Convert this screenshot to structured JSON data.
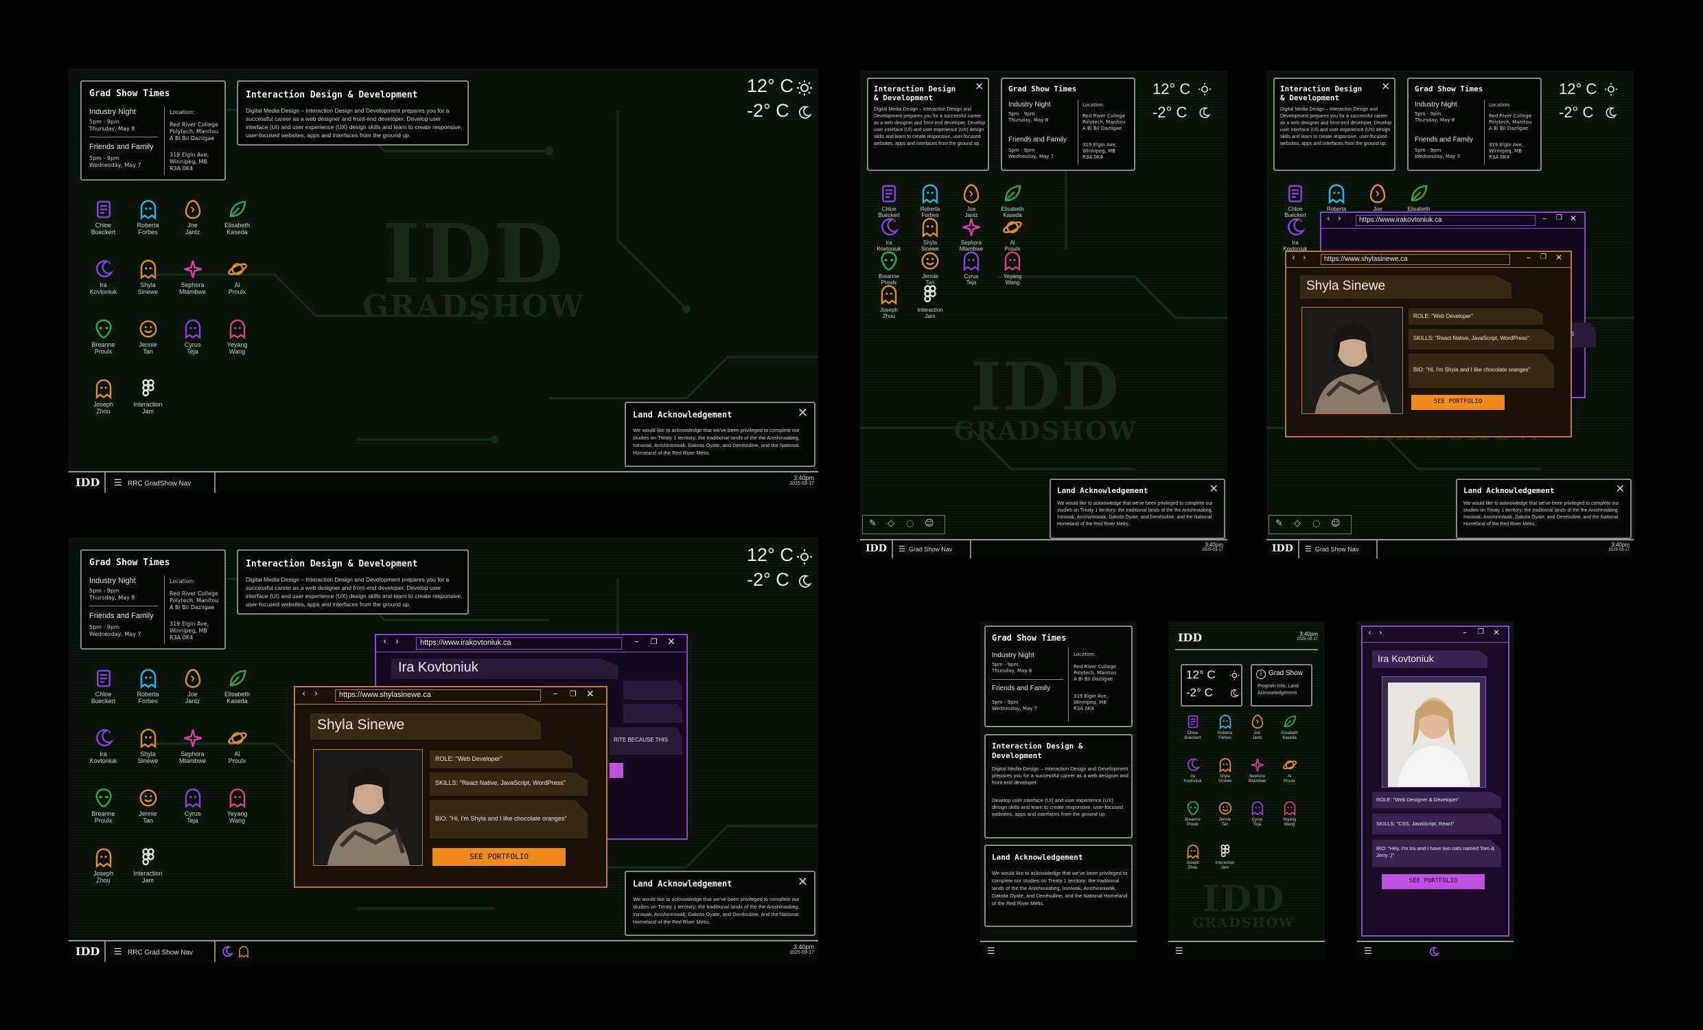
{
  "grad_show": {
    "title": "Grad Show Times",
    "industry_title": "Industry Night",
    "industry_time": "5pm - 9pm",
    "industry_date": "Thursday, May 8",
    "friends_title": "Friends and Family",
    "friends_time": "5pm - 9pm",
    "friends_date": "Wednesday, May 7",
    "location_label": "Location:",
    "location_1_l1": "Red River College",
    "location_1_l2": "Polytech, Manitou",
    "location_1_l3": "A Bi Bii Daziigae",
    "location_2_l1": "319 Elgin Ave,",
    "location_2_l2": "Winnipeg, MB",
    "location_2_l3": "R3A 0K4"
  },
  "idd": {
    "title": "Interaction Design & Development",
    "title_l1": "Interaction Design",
    "title_l2": "& Development",
    "body": "Digital Media Design – Interaction Design and Development prepares you for a successful career as a web designer and front-end developer. Develop user interface (UI) and user experience (UX) design skills and learn to create responsive, user-focused websites, apps and interfaces from the ground up.",
    "body_p1": "Digital Media Design – Interaction Design and Development prepares you for a successful career as a web designer and front-end developer.",
    "body_p2": "Develop user interface (UI) and user experience (UX) design skills and learn to create responsive, user-focused websites, apps and interfaces from the ground up."
  },
  "land": {
    "title": "Land Acknowledgement",
    "body": "We would like to acknowledge that we've been privileged to complete our studies on Treaty 1 territory; the traditional lands of the the Anishinaabeg, Ininiwak, Anishininiwak, Dakota Oyate, and Denésuline, and the National Homeland of the Red River Métis."
  },
  "weather": {
    "high": "12° C",
    "low": "-2° C"
  },
  "watermark": {
    "l1": "IDD",
    "l2": "GRADSHOW"
  },
  "taskbar": {
    "logo": "IDD",
    "nav_label_a": "RRC GradShow Nav",
    "nav_label_b": "RRC Grad Show Nav",
    "nav_label_c": "Grad Show Nav",
    "time": "3:40pm",
    "date": "2025-03-17"
  },
  "students": [
    {
      "first": "Chloe",
      "last": "Bueckert",
      "icon": "scroll-icon",
      "color": "#8b3fd6"
    },
    {
      "first": "Roberta",
      "last": "Forbes",
      "icon": "ghost-icon",
      "color": "#2ab4e6"
    },
    {
      "first": "Joe",
      "last": "Jantz",
      "icon": "egg-icon",
      "color": "#e08a2a"
    },
    {
      "first": "Elisabeth",
      "last": "Kaseda",
      "icon": "leaf-icon",
      "color": "#2aa84a"
    },
    {
      "first": "Ira",
      "last": "Kovtoniuk",
      "icon": "moon-icon",
      "color": "#8b3fd6"
    },
    {
      "first": "Shyla",
      "last": "Sinewe",
      "icon": "ghost-icon",
      "color": "#e08a2a"
    },
    {
      "first": "Sephora",
      "last": "Mtambwe",
      "icon": "sparkle-icon",
      "color": "#d63fb0"
    },
    {
      "first": "Al",
      "last": "Proulx",
      "icon": "planet-icon",
      "color": "#e08a2a"
    },
    {
      "first": "Breanne",
      "last": "Proulx",
      "icon": "alien-icon",
      "color": "#2aa84a"
    },
    {
      "first": "Jennie",
      "last": "Tan",
      "icon": "smile-icon",
      "color": "#e08a2a"
    },
    {
      "first": "Cyrus",
      "last": "Teja",
      "icon": "ghost-icon",
      "color": "#8b3fd6"
    },
    {
      "first": "Yeyang",
      "last": "Wang",
      "icon": "ghost-icon",
      "color": "#d63f8a"
    },
    {
      "first": "Joseph",
      "last": "Zhou",
      "icon": "ghost-icon",
      "color": "#e08a2a"
    },
    {
      "first": "Interaction",
      "last": "Jam",
      "icon": "figma-icon",
      "color": "#e0e0e0"
    }
  ],
  "shyla_window": {
    "url": "https://www.shylasinewe.ca",
    "name": "Shyla Sinewe",
    "role": "ROLE: \"Web Developer\"",
    "skills": "SKILLS:  \"React Native, JavaScript, WordPress\"",
    "bio": "BIO: \"Hi, I'm Shyla and I like chocolate oranges\"",
    "button": "SEE PORTFOLIO"
  },
  "ira_window": {
    "url": "https://www.irakovtoniuk.ca",
    "name": "Ira Kovtoniuk",
    "role": "ROLE: \"Web Designer & Developer\"",
    "skills": "SKILLS:  \"CSS, JavaScript, React\"",
    "bio": "BIO: \"Hey, I'm Ira and I have two cats named Tom & Jerry :)\"",
    "button": "SEE PORTFOLIO",
    "peek_text": "RITE BECAUSE THIS",
    "peek_text_b": "THIS"
  },
  "mobile": {
    "gradshow_title": "Grad Show",
    "gradshow_sub": "Program Info, Land Acknowledgement"
  },
  "colors": {
    "orange": "#e8891a",
    "purple": "#b04ae0",
    "bg": "#081208"
  }
}
